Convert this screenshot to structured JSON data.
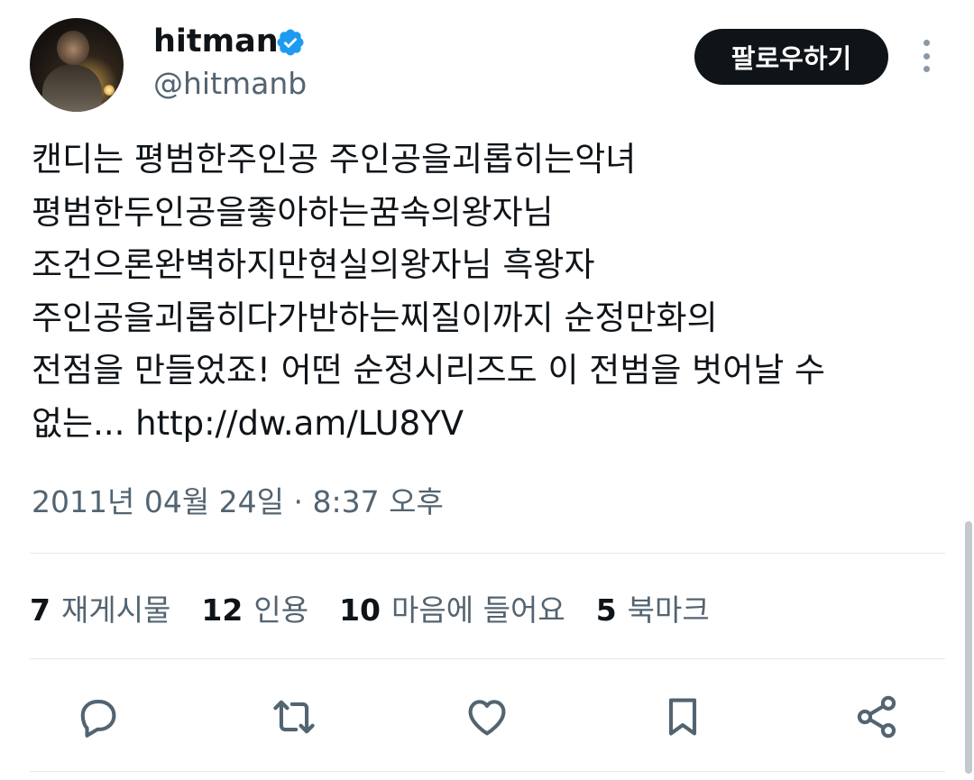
{
  "author": {
    "display_name": "hitman",
    "handle": "@hitmanb",
    "verified": true
  },
  "follow_button": {
    "label": "팔로우하기"
  },
  "tweet": {
    "lines": [
      "캔디는 평범한주인공 주인공을괴롭히는악녀",
      "평범한두인공을좋아하는꿈속의왕자님",
      "조건으론완벽하지만현실의왕자님 흑왕자",
      "주인공을괴롭히다가반하는찌질이까지 순정만화의",
      "전점을 만들었죠! 어떤 순정시리즈도 이 전범을 벗어날 수",
      "없는... http://dw.am/LU8YV"
    ],
    "timestamp": "2011년 04월 24일 · 8:37 오후"
  },
  "stats": [
    {
      "count": "7",
      "label": "재게시물"
    },
    {
      "count": "12",
      "label": "인용"
    },
    {
      "count": "10",
      "label": "마음에 들어요"
    },
    {
      "count": "5",
      "label": "북마크"
    }
  ],
  "actions": [
    {
      "icon": "reply-icon"
    },
    {
      "icon": "retweet-icon"
    },
    {
      "icon": "like-icon"
    },
    {
      "icon": "bookmark-icon"
    },
    {
      "icon": "share-icon"
    }
  ],
  "colors": {
    "text_primary": "#0f1419",
    "text_secondary": "#536471",
    "verified_blue": "#1d9bf0",
    "button_bg": "#0f1419",
    "icon_gray": "#536471",
    "divider": "#e6e9ec"
  }
}
